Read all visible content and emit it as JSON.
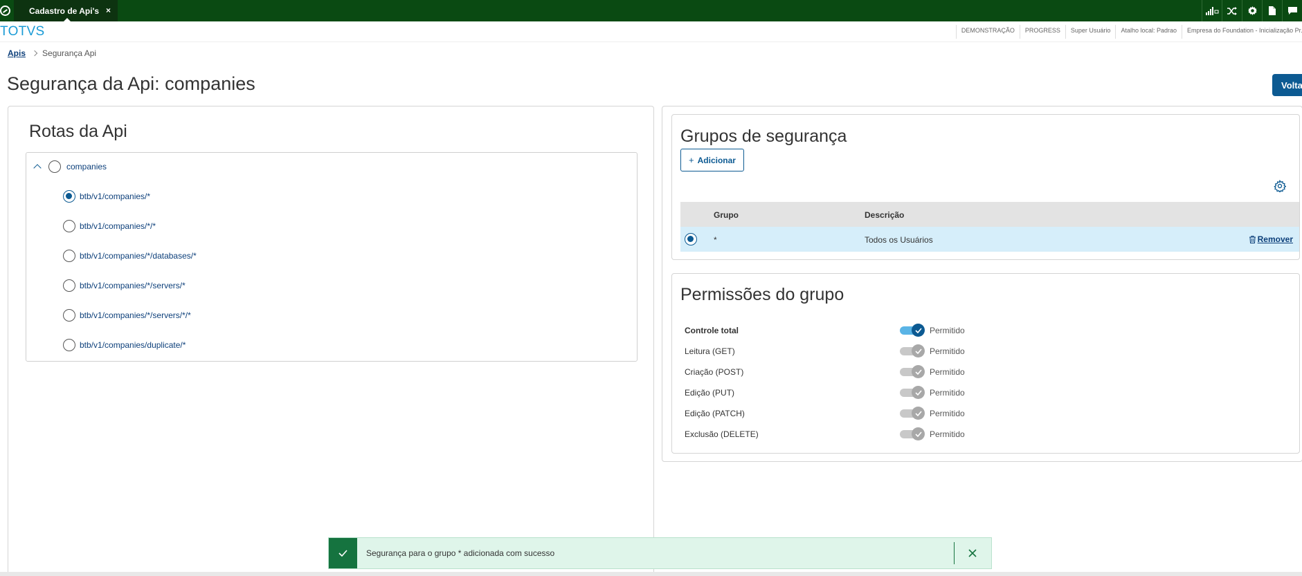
{
  "topbar": {
    "tab_label": "Cadastro de Api's",
    "tab_close": "×",
    "icons": [
      "signal-icon",
      "shuffle-icon",
      "gear-icon",
      "document-icon",
      "chat-icon"
    ]
  },
  "header": {
    "brand": "TOTVS",
    "info_items": [
      "DEMONSTRAÇÃO",
      "PROGRESS",
      "Super Usuário",
      "Atalho local: Padrao",
      "Empresa do Foundation - Inicialização Pr..."
    ]
  },
  "breadcrumb": {
    "link": "Apis",
    "current": "Segurança Api"
  },
  "page": {
    "title": "Segurança da Api: companies",
    "back_label": "Voltar"
  },
  "routes_panel": {
    "title": "Rotas da Api",
    "root_label": "companies",
    "routes": [
      {
        "label": "btb/v1/companies/*",
        "selected": true
      },
      {
        "label": "btb/v1/companies/*/*",
        "selected": false
      },
      {
        "label": "btb/v1/companies/*/databases/*",
        "selected": false
      },
      {
        "label": "btb/v1/companies/*/servers/*",
        "selected": false
      },
      {
        "label": "btb/v1/companies/*/servers/*/*",
        "selected": false
      },
      {
        "label": "btb/v1/companies/duplicate/*",
        "selected": false
      }
    ]
  },
  "groups_panel": {
    "title": "Grupos de segurança",
    "add_plus": "+",
    "add_label": "Adicionar",
    "columns": [
      "Grupo",
      "Descrição"
    ],
    "rows": [
      {
        "grupo": "*",
        "descricao": "Todos os Usuários",
        "action": "Remover"
      }
    ]
  },
  "permissions_panel": {
    "title": "Permissões do grupo",
    "items": [
      {
        "label": "Controle total",
        "status": "Permitido",
        "on": true
      },
      {
        "label": "Leitura (GET)",
        "status": "Permitido",
        "on": false
      },
      {
        "label": "Criação (POST)",
        "status": "Permitido",
        "on": false
      },
      {
        "label": "Edição (PUT)",
        "status": "Permitido",
        "on": false
      },
      {
        "label": "Edição (PATCH)",
        "status": "Permitido",
        "on": false
      },
      {
        "label": "Exclusão (DELETE)",
        "status": "Permitido",
        "on": false
      }
    ]
  },
  "toast": {
    "message": "Segurança para o grupo * adicionada com sucesso"
  },
  "colors": {
    "topbar": "#0a4a12",
    "brand": "#1a9bd6",
    "primary": "#0c5a92",
    "selected_row": "#d6eefa",
    "toast_bg": "#dff5ea",
    "toast_accent": "#15733f"
  }
}
